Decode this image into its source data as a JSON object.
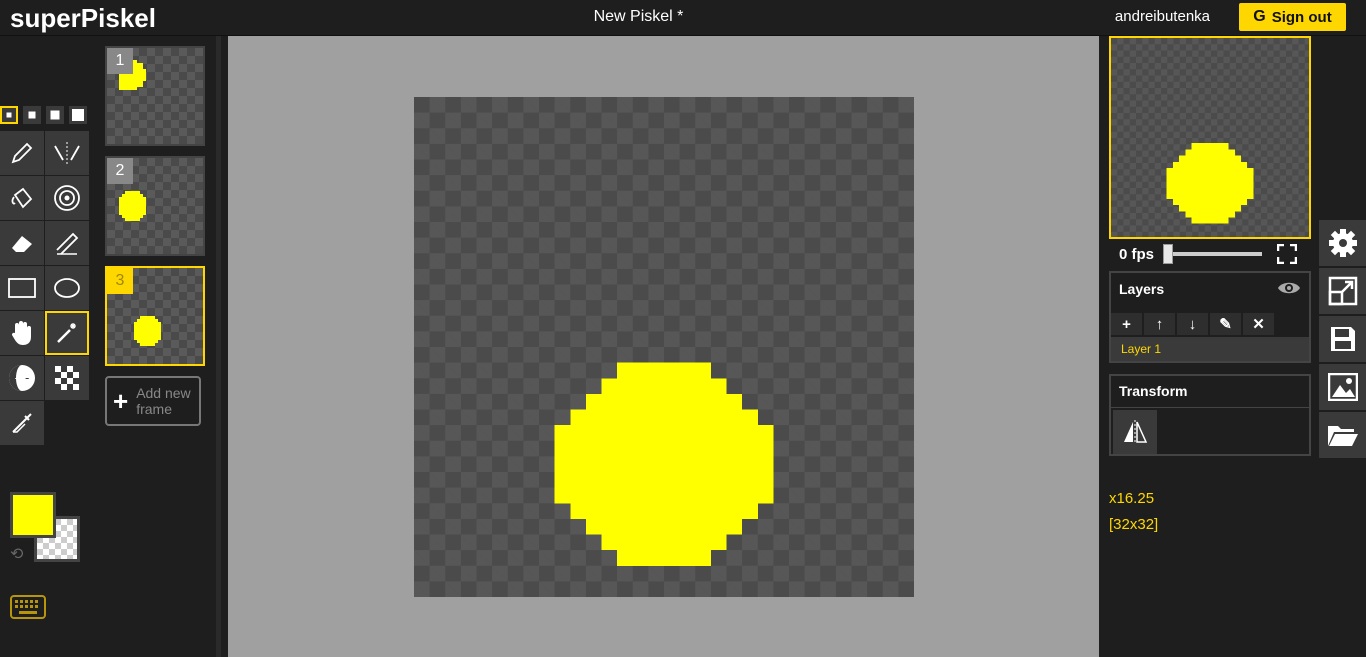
{
  "header": {
    "brand": "superPiskel",
    "title": "New Piskel *",
    "username": "andreibutenka",
    "signout_label": "Sign out",
    "signout_glyph": "G"
  },
  "colors": {
    "accent": "#ffd700",
    "primary": "#ffff00",
    "secondary": "transparent",
    "stage_bg": "#a0a0a0"
  },
  "tools": {
    "pen_sizes": [
      1,
      2,
      3,
      4
    ],
    "selected_pen_size": 1,
    "items": [
      "pen-icon",
      "vertical-mirror-pen-icon",
      "paint-bucket-icon",
      "paint-same-pixels-icon",
      "eraser-icon",
      "stroke-icon",
      "rectangle-icon",
      "circle-icon",
      "move-hand-icon",
      "magic-wand-select-icon",
      "lighten-icon",
      "dithering-icon",
      "color-picker-icon"
    ],
    "selected_tool": "magic-wand-select-icon"
  },
  "frames": {
    "items": [
      {
        "number": "1"
      },
      {
        "number": "2"
      },
      {
        "number": "3"
      }
    ],
    "selected": "3",
    "add_label_line1": "Add new",
    "add_label_line2": "frame"
  },
  "preview": {
    "fps_label": "0 fps",
    "fps": 0
  },
  "layers": {
    "title": "Layers",
    "buttons": [
      "+",
      "↑",
      "↓",
      "✎",
      "✕"
    ],
    "items": [
      {
        "name": "Layer 1"
      }
    ]
  },
  "transform": {
    "title": "Transform"
  },
  "status": {
    "zoom": "x16.25",
    "size": "[32x32]"
  },
  "side_icons": [
    "settings-icon",
    "resize-icon",
    "save-icon",
    "export-image-icon",
    "open-folder-icon"
  ]
}
